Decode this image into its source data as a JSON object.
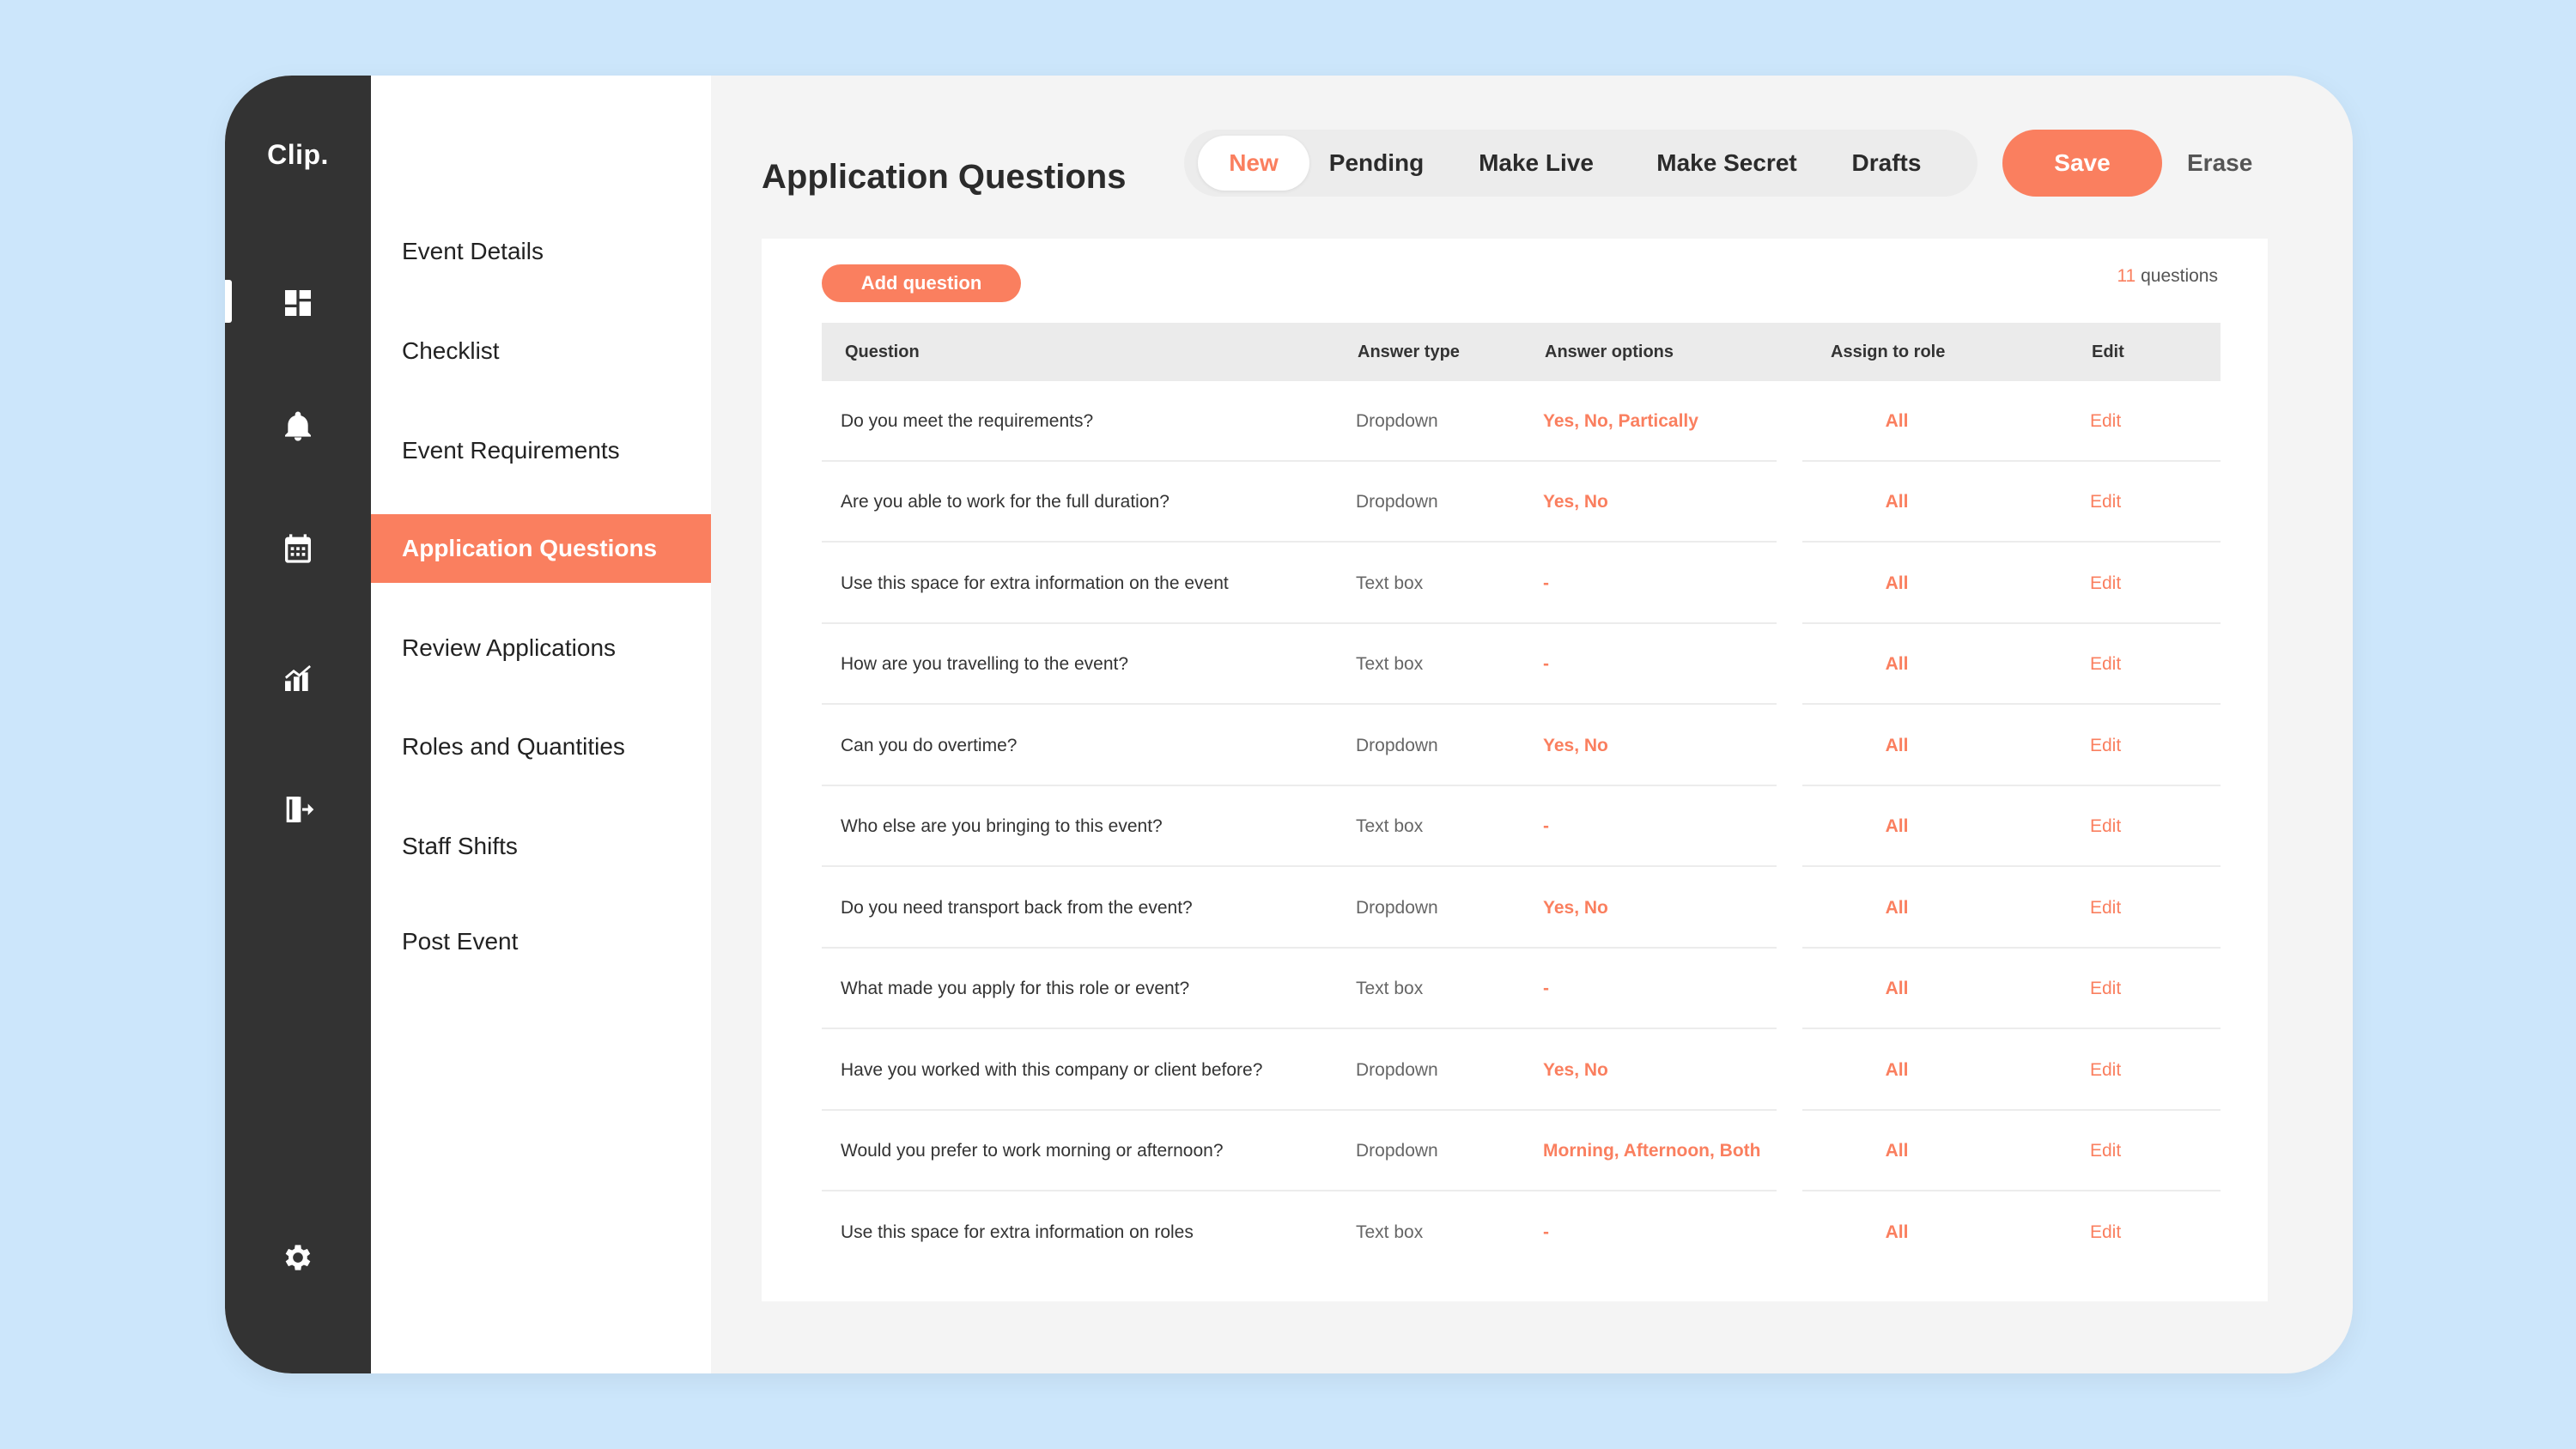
{
  "app": {
    "logo": "Clip."
  },
  "rail": {
    "icons": [
      "dashboard-icon",
      "bell-icon",
      "calendar-icon",
      "analytics-icon",
      "export-icon",
      "settings-icon"
    ]
  },
  "subnav": {
    "items": [
      {
        "label": "Event Details",
        "active": false
      },
      {
        "label": "Checklist",
        "active": false
      },
      {
        "label": "Event Requirements",
        "active": false
      },
      {
        "label": "Application Questions",
        "active": true
      },
      {
        "label": "Review Applications",
        "active": false
      },
      {
        "label": "Roles and Quantities",
        "active": false
      },
      {
        "label": "Staff Shifts",
        "active": false
      },
      {
        "label": "Post Event",
        "active": false
      }
    ]
  },
  "header": {
    "title": "Application Questions",
    "tabs": [
      {
        "label": "New",
        "active": true
      },
      {
        "label": "Pending",
        "active": false
      },
      {
        "label": "Make Live",
        "active": false
      },
      {
        "label": "Make Secret",
        "active": false
      },
      {
        "label": "Drafts",
        "active": false
      }
    ],
    "save_label": "Save",
    "erase_label": "Erase"
  },
  "questions": {
    "add_label": "Add question",
    "count_number": "11",
    "count_suffix": "questions",
    "columns": [
      "Question",
      "Answer type",
      "Answer options",
      "Assign to role",
      "Edit"
    ],
    "rows": [
      {
        "question": "Do you meet the requirements?",
        "type": "Dropdown",
        "options": "Yes, No, Partically",
        "role": "All",
        "edit": "Edit"
      },
      {
        "question": "Are you able to work for the full duration?",
        "type": "Dropdown",
        "options": "Yes, No",
        "role": "All",
        "edit": "Edit"
      },
      {
        "question": "Use this space for extra information on the event",
        "type": "Text box",
        "options": "-",
        "role": "All",
        "edit": "Edit"
      },
      {
        "question": "How are you travelling to the event?",
        "type": "Text box",
        "options": "-",
        "role": "All",
        "edit": "Edit"
      },
      {
        "question": "Can you do overtime?",
        "type": "Dropdown",
        "options": "Yes, No",
        "role": "All",
        "edit": "Edit"
      },
      {
        "question": "Who else are you bringing  to this event?",
        "type": "Text box",
        "options": "-",
        "role": "All",
        "edit": "Edit"
      },
      {
        "question": "Do you need transport back from the event?",
        "type": "Dropdown",
        "options": "Yes, No",
        "role": "All",
        "edit": "Edit"
      },
      {
        "question": "What made you apply for this role or event?",
        "type": "Text box",
        "options": "-",
        "role": "All",
        "edit": "Edit"
      },
      {
        "question": "Have you worked with this company or client before?",
        "type": "Dropdown",
        "options": "Yes, No",
        "role": "All",
        "edit": "Edit"
      },
      {
        "question": "Would you prefer to work morning or afternoon?",
        "type": "Dropdown",
        "options": "Morning, Afternoon, Both",
        "role": "All",
        "edit": "Edit"
      },
      {
        "question": "Use this space for extra information on roles",
        "type": "Text box",
        "options": "-",
        "role": "All",
        "edit": "Edit"
      }
    ]
  },
  "colors": {
    "accent": "#fa7f5f",
    "rail": "#333333",
    "background": "#cce6fb"
  }
}
